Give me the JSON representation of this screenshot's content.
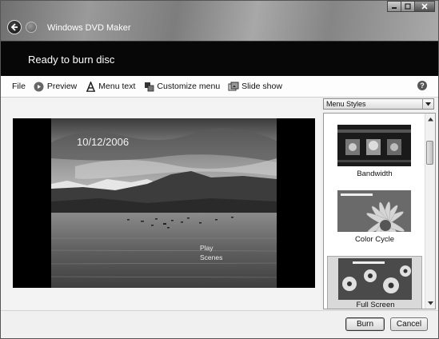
{
  "window": {
    "app_title": "Windows DVD Maker",
    "controls": [
      "minimize-icon",
      "maximize-icon",
      "close-icon"
    ]
  },
  "banner": {
    "status_text": "Ready to burn disc"
  },
  "toolbar": {
    "items": [
      {
        "label": "File",
        "icon": ""
      },
      {
        "label": "Preview",
        "icon": "play-icon"
      },
      {
        "label": "Menu text",
        "icon": "text-icon"
      },
      {
        "label": "Customize menu",
        "icon": "customize-icon"
      },
      {
        "label": "Slide show",
        "icon": "slideshow-icon"
      }
    ],
    "help_label": "?"
  },
  "preview": {
    "date_text": "10/12/2006",
    "play_line1": "Play",
    "play_line2": "Scenes"
  },
  "styles_panel": {
    "dropdown_value": "Menu Styles",
    "items": [
      {
        "name": "Bandwidth",
        "selected": false
      },
      {
        "name": "Color Cycle",
        "selected": false
      },
      {
        "name": "Full Screen",
        "selected": true
      }
    ]
  },
  "footer": {
    "burn_label": "Burn",
    "cancel_label": "Cancel"
  }
}
